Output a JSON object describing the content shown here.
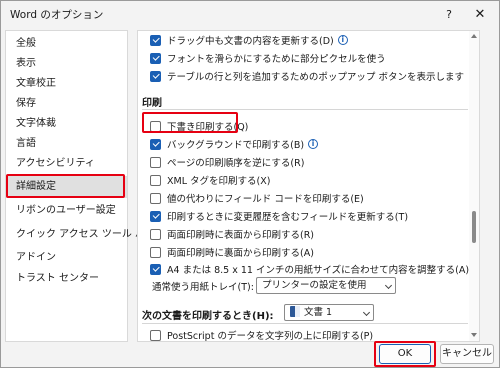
{
  "window": {
    "title": "Word のオプション",
    "help_label": "?",
    "close_label": "✕"
  },
  "sidebar": {
    "items": [
      {
        "label": "全般"
      },
      {
        "label": "表示"
      },
      {
        "label": "文章校正"
      },
      {
        "label": "保存"
      },
      {
        "label": "文字体裁"
      },
      {
        "label": "言語"
      },
      {
        "label": "アクセシビリティ"
      },
      {
        "label": "詳細設定",
        "selected": true
      },
      {
        "label": "リボンのユーザー設定"
      },
      {
        "label": "クイック アクセス ツール バー"
      },
      {
        "label": "アドイン"
      },
      {
        "label": "トラスト センター"
      }
    ]
  },
  "display_options": [
    {
      "label": "ドラッグ中も文書の内容を更新する(D)",
      "checked": true,
      "info": true
    },
    {
      "label": "フォントを滑らかにするために部分ピクセルを使う",
      "checked": true
    },
    {
      "label": "テーブルの行と列を追加するためのポップアップ ボタンを表示します",
      "checked": true
    }
  ],
  "print_section": {
    "title": "印刷",
    "options": [
      {
        "label": "下書き印刷する(Q)",
        "checked": false
      },
      {
        "label": "バックグラウンドで印刷する(B)",
        "checked": true,
        "info": true
      },
      {
        "label": "ページの印刷順序を逆にする(R)",
        "checked": false
      },
      {
        "label": "XML タグを印刷する(X)",
        "checked": false
      },
      {
        "label": "値の代わりにフィールド コードを印刷する(E)",
        "checked": false
      },
      {
        "label": "印刷するときに変更履歴を含むフィールドを更新する(T)",
        "checked": true
      },
      {
        "label": "両面印刷時に表面から印刷する(R)",
        "checked": false
      },
      {
        "label": "両面印刷時に裏面から印刷する(A)",
        "checked": false
      },
      {
        "label": "A4 または 8.5 x 11 インチの用紙サイズに合わせて内容を調整する(A)",
        "checked": true
      }
    ],
    "tray_label": "通常使う用紙トレイ(T):",
    "tray_value": "プリンターの設定を使用"
  },
  "document_section": {
    "title": "次の文書を印刷するとき(H):",
    "document_value": "文書 1",
    "options": [
      {
        "label": "PostScript のデータを文字列の上に印刷する(P)",
        "checked": false
      }
    ]
  },
  "buttons": {
    "ok": "OK",
    "cancel": "キャンセル"
  },
  "colors": {
    "accent": "#1a5fb4",
    "highlight": "#e60012"
  }
}
